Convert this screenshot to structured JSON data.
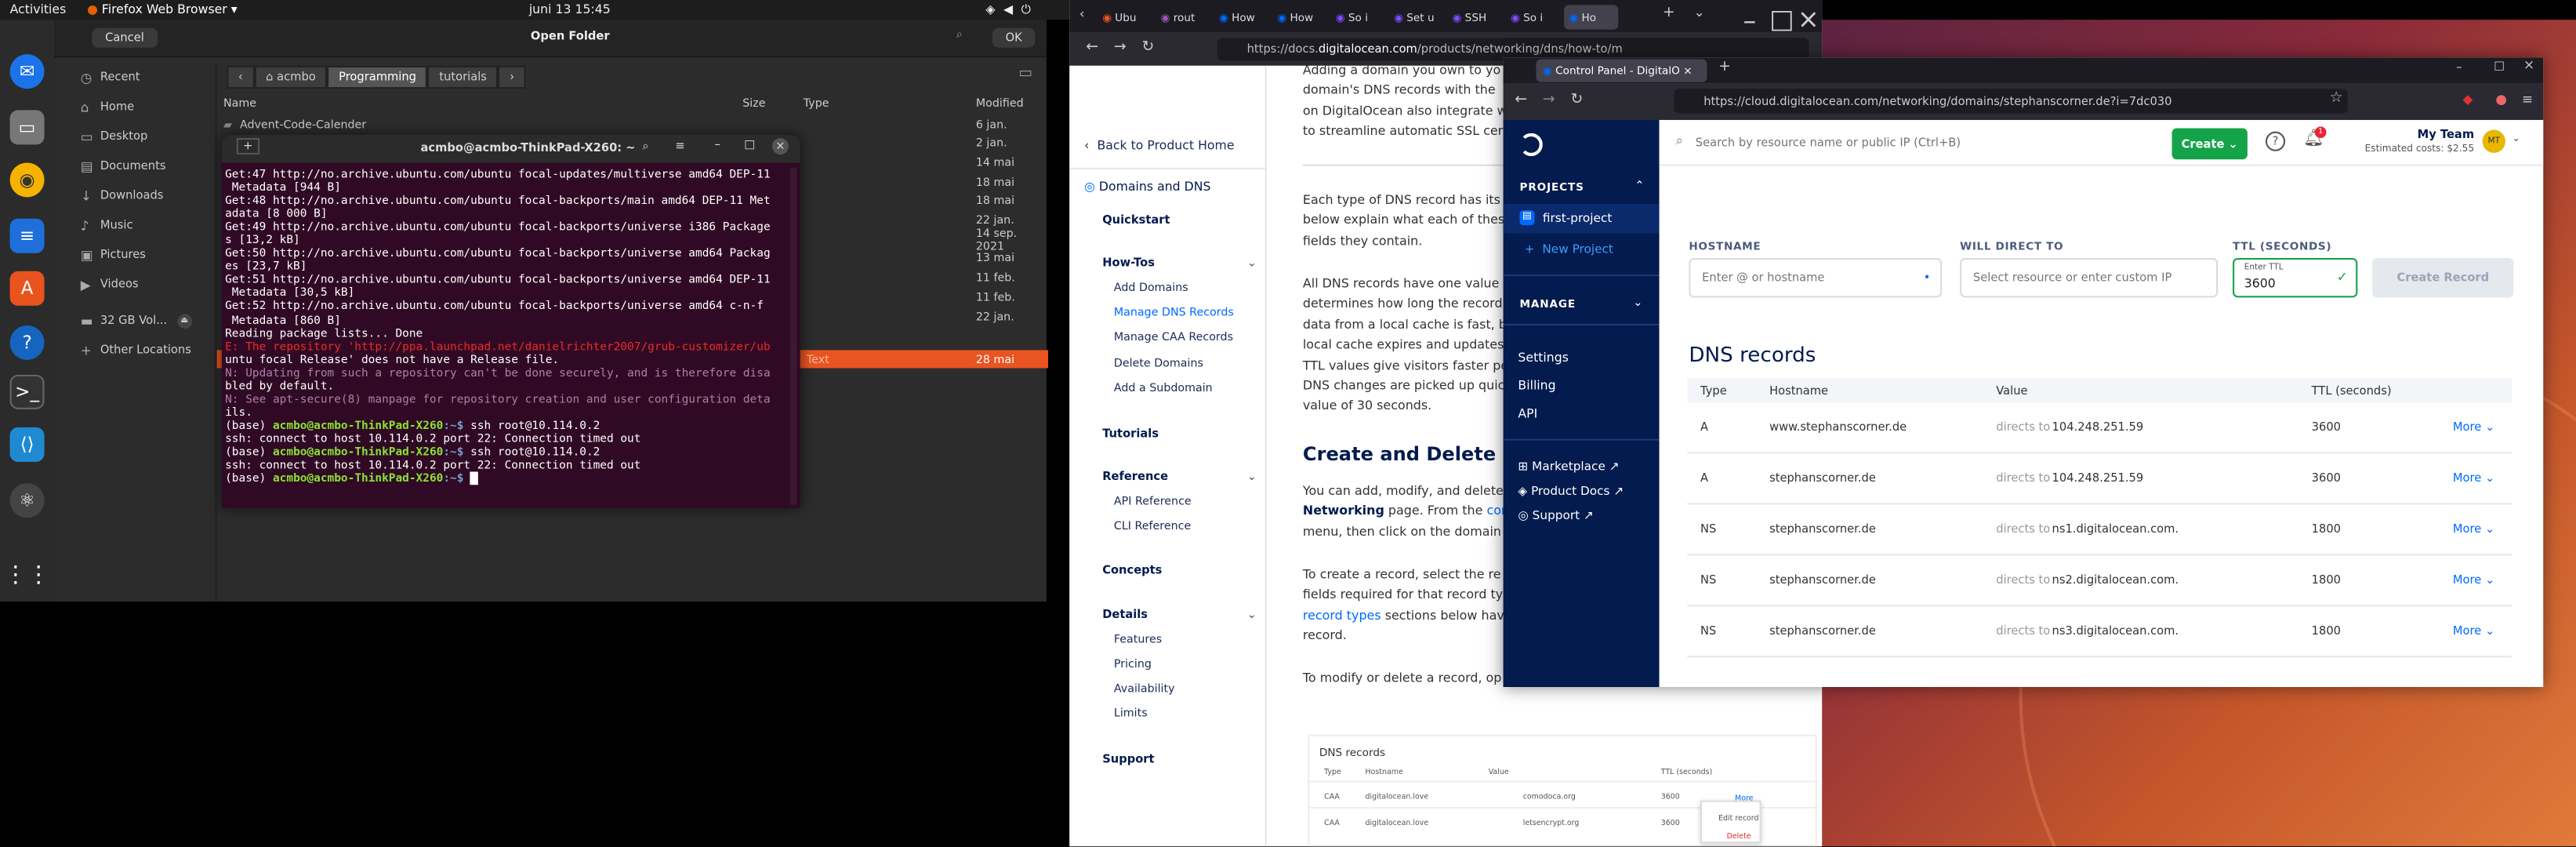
{
  "topbar": {
    "activities": "Activities",
    "app": "Firefox Web Browser",
    "datetime": "juni 13  15:45"
  },
  "nautilus": {
    "cancel": "Cancel",
    "title": "Open Folder",
    "ok": "OK",
    "sidebar": [
      "Recent",
      "Home",
      "Desktop",
      "Documents",
      "Downloads",
      "Music",
      "Pictures",
      "Videos",
      "32 GB Vol...",
      "Other Locations"
    ],
    "crumbs": [
      "acmbo",
      "Programming",
      "tutorials"
    ],
    "columns": {
      "name": "Name",
      "size": "Size",
      "type": "Type",
      "modified": "Modified"
    },
    "rows": [
      {
        "name": "Advent-Code-Calender",
        "modified": "6 jan."
      },
      {
        "name": "",
        "modified": "2 jan."
      },
      {
        "name": "",
        "modified": "14 mai"
      },
      {
        "name": "",
        "modified": "18 mai"
      },
      {
        "name": "",
        "modified": "18 mai"
      },
      {
        "name": "",
        "modified": "22 jan."
      },
      {
        "name": "",
        "modified": "14 sep. 2021"
      },
      {
        "name": "",
        "modified": "13 mai"
      },
      {
        "name": "",
        "modified": "11 feb."
      },
      {
        "name": "",
        "modified": "11 feb."
      },
      {
        "name": "",
        "modified": "22 jan."
      }
    ],
    "selected_type": "Text",
    "selected_modified": "28 mai"
  },
  "terminal": {
    "title": "acmbo@acmbo-ThinkPad-X260: ~",
    "lines": [
      "Get:47 http://no.archive.ubuntu.com/ubuntu focal-updates/multiverse amd64 DEP-11",
      " Metadata [944 B]",
      "Get:48 http://no.archive.ubuntu.com/ubuntu focal-backports/main amd64 DEP-11 Met",
      "adata [8 000 B]",
      "Get:49 http://no.archive.ubuntu.com/ubuntu focal-backports/universe i386 Package",
      "s [13,2 kB]",
      "Get:50 http://no.archive.ubuntu.com/ubuntu focal-backports/universe amd64 Packag",
      "es [23,7 kB]",
      "Get:51 http://no.archive.ubuntu.com/ubuntu focal-backports/universe amd64 DEP-11",
      " Metadata [30,5 kB]",
      "Get:52 http://no.archive.ubuntu.com/ubuntu focal-backports/universe amd64 c-n-f",
      " Metadata [860 B]",
      "Reading package lists... Done",
      "E: The repository 'http://ppa.launchpad.net/danielrichter2007/grub-customizer/ub",
      "untu focal Release' does not have a Release file.",
      "N: Updating from such a repository can't be done securely, and is therefore disa",
      "bled by default.",
      "N: See apt-secure(8) manpage for repository creation and user configuration deta",
      "ils."
    ],
    "prompt_env": "(base) ",
    "prompt_user": "acmbo@acmbo-ThinkPad-X260",
    "prompt_path": ":~$ ",
    "cmd1": "ssh root@10.114.0.2",
    "out1": "ssh: connect to host 10.114.0.2 port 22: Connection timed out",
    "cmd2": "ssh root@10.114.0.2",
    "out2": "ssh: connect to host 10.114.0.2 port 22: Connection timed out"
  },
  "firefox_docs": {
    "tabs": [
      "Ubu",
      "rout",
      "How",
      "How",
      "So i",
      "Set u",
      "SSH",
      "So i",
      "Ho"
    ],
    "url_prefix": "https://docs.",
    "url_domain": "digitalocean.com",
    "url_rest": "/products/networking/dns/how-to/m",
    "sidebar": {
      "back": "Back to Product Home",
      "section": "Domains and DNS",
      "quickstart": "Quickstart",
      "howtos": "How-Tos",
      "howto_items": [
        "Add Domains",
        "Manage DNS Records",
        "Manage CAA Records",
        "Delete Domains",
        "Add a Subdomain"
      ],
      "tutorials": "Tutorials",
      "reference": "Reference",
      "reference_items": [
        "API Reference",
        "CLI Reference"
      ],
      "concepts": "Concepts",
      "details": "Details",
      "detail_items": [
        "Features",
        "Pricing",
        "Availability",
        "Limits"
      ],
      "support": "Support"
    },
    "content": {
      "p1": [
        "Adding a domain you own to yo",
        "domain's DNS records with the",
        "on DigitalOcean also integrate w",
        "to streamline automatic SSL cert"
      ],
      "p2": [
        "Each type of DNS record has its",
        "below explain what each of thes",
        "fields they contain."
      ],
      "p3": [
        "All DNS records have one value",
        "determines how long the record",
        "data from a local cache is fast, b",
        "local cache expires and updates",
        "TTL values give visitors faster pe",
        "DNS changes are picked up quic",
        "value of 30 seconds."
      ],
      "heading": "Create and Delete Rec",
      "p4a": "You can add, modify, and delete",
      "p4b_bold": "Networking",
      "p4b": " page. From the ",
      "p4b_link": "con",
      "p4c": "menu, then click on the domain",
      "p5": [
        "To create a record, select the re",
        "fields required for that record typ"
      ],
      "p5_link": "record types",
      "p5c": " sections below hav",
      "p5d": "record.",
      "p6": "To modify or delete a record, op",
      "mini_title": "DNS records",
      "mini_cols": [
        "Type",
        "Hostname",
        "Value",
        "TTL (seconds)"
      ],
      "mini_rows": [
        {
          "type": "CAA",
          "host": "digitalocean.love",
          "value": "comodoca.org",
          "ttl": "3600"
        },
        {
          "type": "CAA",
          "host": "digitalocean.love",
          "value": "letsencrypt.org",
          "ttl": "3600"
        }
      ],
      "mini_more": "More",
      "mini_menu": [
        "Edit record",
        "Delete"
      ]
    }
  },
  "do_window": {
    "tab_title": "Control Panel - DigitalO",
    "url": "https://cloud.digitalocean.com/networking/domains/stephanscorner.de?i=7dc030",
    "search_placeholder": "Search by resource name or public IP (Ctrl+B)",
    "create": "Create",
    "team": "My Team",
    "costs": "Estimated costs: $2.55",
    "avatar": "MT",
    "notif_count": "1",
    "side": {
      "projects": "PROJECTS",
      "project": "first-project",
      "new_project": "New Project",
      "manage": "MANAGE",
      "items": [
        "Settings",
        "Billing",
        "API"
      ],
      "links": [
        "Marketplace",
        "Product Docs",
        "Support"
      ]
    },
    "form": {
      "hostname_label": "HOSTNAME",
      "hostname_placeholder": "Enter @ or hostname",
      "direct_label": "WILL DIRECT TO",
      "direct_placeholder": "Select resource or enter custom IP",
      "ttl_label": "TTL (SECONDS)",
      "ttl_small": "Enter TTL",
      "ttl_value": "3600",
      "create_record": "Create Record"
    },
    "dns_title": "DNS records",
    "columns": [
      "Type",
      "Hostname",
      "Value",
      "TTL (seconds)"
    ],
    "directs_to": "directs to",
    "more": "More",
    "records": [
      {
        "type": "A",
        "hostname": "www.stephanscorner.de",
        "value": "104.248.251.59",
        "ttl": "3600"
      },
      {
        "type": "A",
        "hostname": "stephanscorner.de",
        "value": "104.248.251.59",
        "ttl": "3600"
      },
      {
        "type": "NS",
        "hostname": "stephanscorner.de",
        "value": "ns1.digitalocean.com.",
        "ttl": "1800"
      },
      {
        "type": "NS",
        "hostname": "stephanscorner.de",
        "value": "ns2.digitalocean.com.",
        "ttl": "1800"
      },
      {
        "type": "NS",
        "hostname": "stephanscorner.de",
        "value": "ns3.digitalocean.com.",
        "ttl": "1800"
      }
    ]
  }
}
